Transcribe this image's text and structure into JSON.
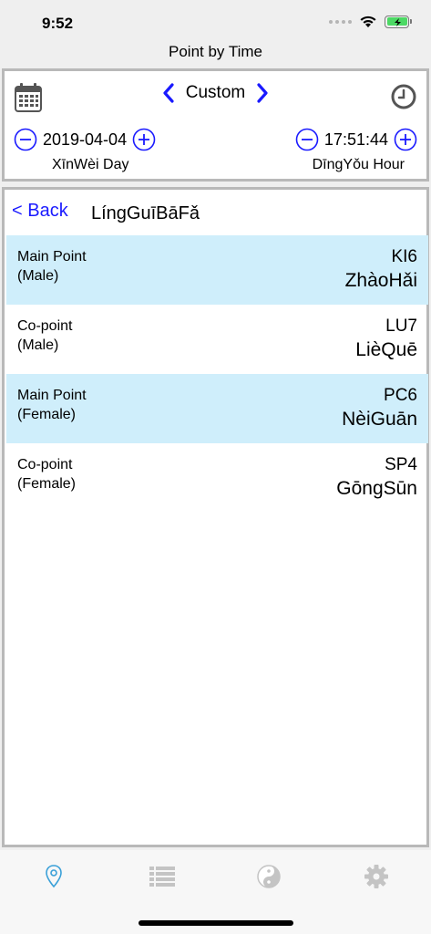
{
  "status": {
    "time": "9:52"
  },
  "nav": {
    "title": "Point by Time"
  },
  "selector": {
    "mode_label": "Custom",
    "date_value": "2019-04-04",
    "date_sub": "XīnWèi Day",
    "time_value": "17:51:44",
    "time_sub": "DīngYǒu Hour"
  },
  "main": {
    "back_label": "< Back",
    "title": "LíngGuīBāFǎ",
    "rows": [
      {
        "label_line1": "Main Point",
        "label_line2": "(Male)",
        "code": "KI6",
        "name": "ZhàoHǎi",
        "highlight": true
      },
      {
        "label_line1": "Co-point",
        "label_line2": "(Male)",
        "code": "LU7",
        "name": "LièQuē",
        "highlight": false
      },
      {
        "label_line1": "Main Point",
        "label_line2": "(Female)",
        "code": "PC6",
        "name": "NèiGuān",
        "highlight": true
      },
      {
        "label_line1": "Co-point",
        "label_line2": "(Female)",
        "code": "SP4",
        "name": "GōngSūn",
        "highlight": false
      }
    ]
  },
  "colors": {
    "accent": "#1a1aff",
    "highlight_row": "#cfeefb",
    "tab_active": "#3aa0d8",
    "tab_inactive": "#c4c4c4"
  },
  "tabs": [
    {
      "icon": "location-pin-icon",
      "active": true
    },
    {
      "icon": "list-icon",
      "active": false
    },
    {
      "icon": "yin-yang-icon",
      "active": false
    },
    {
      "icon": "gear-icon",
      "active": false
    }
  ]
}
